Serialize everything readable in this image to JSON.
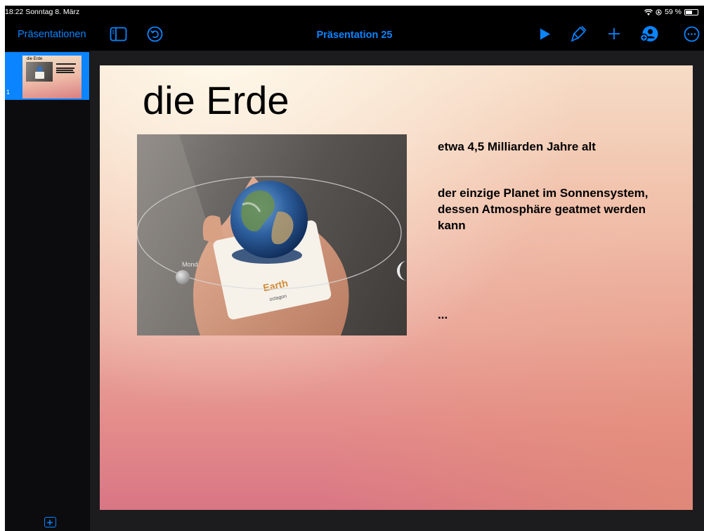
{
  "status": {
    "time_date": "18:22  Sonntag 8. März",
    "battery": "59 %"
  },
  "toolbar": {
    "back_label": "Präsentationen",
    "title": "Präsentation 25",
    "icons": [
      "sidebar-toggle-icon",
      "undo-icon",
      "play-icon",
      "paintbrush-icon",
      "plus-icon",
      "collaborate-icon",
      "more-icon"
    ]
  },
  "navigator": {
    "slides": [
      {
        "number": "1",
        "thumb_title": "die Erde"
      }
    ]
  },
  "slide": {
    "title": "die Erde",
    "image": {
      "card_label": "Earth",
      "card_sublabel": "octagon",
      "moon_label": "Mond"
    },
    "bullets": [
      "etwa 4,5 Milliarden Jahre alt",
      "der einzige Planet im Sonnensystem, dessen Atmosphäre geatmet werden kann",
      "..."
    ]
  },
  "colors": {
    "accent": "#0a84ff",
    "toolbar_bg": "#000000",
    "canvas_bg": "#1c1c1e"
  }
}
